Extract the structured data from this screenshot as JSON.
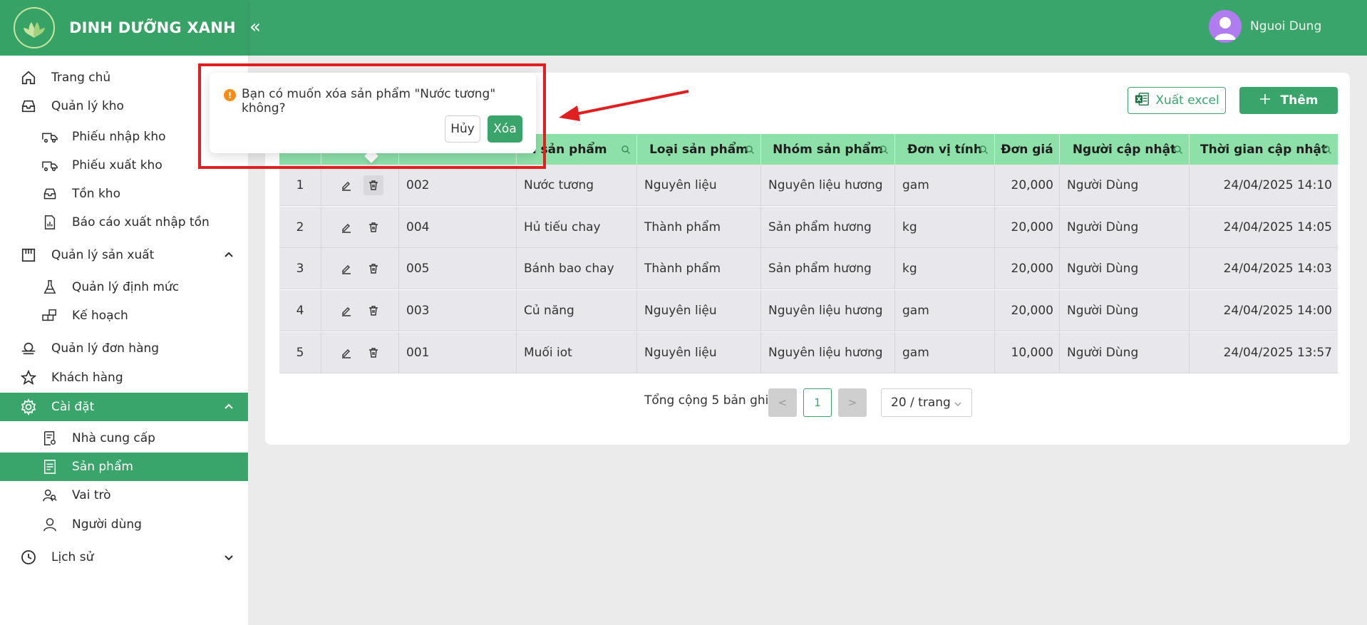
{
  "app": {
    "brand": "DINH DƯỠNG XANH",
    "collapse_icon": "«",
    "user_name": "Nguoi Dung"
  },
  "sidebar": {
    "home": "Trang chủ",
    "warehouse": "Quản lý kho",
    "warehouse_items": [
      "Phiếu nhập kho",
      "Phiếu xuất kho",
      "Tồn kho",
      "Báo cáo xuất nhập tồn"
    ],
    "production": "Quản lý sản xuất",
    "production_items": [
      "Quản lý định mức",
      "Kế hoạch"
    ],
    "orders": "Quản lý đơn hàng",
    "customers": "Khách hàng",
    "settings": "Cài đặt",
    "settings_items": [
      "Nhà cung cấp",
      "Sản phẩm",
      "Vai trò",
      "Người dùng"
    ],
    "history": "Lịch sử"
  },
  "toolbar": {
    "excel_label": "Xuất excel",
    "add_label": "Thêm"
  },
  "table": {
    "headers": {
      "name": "ên sản phẩm",
      "type": "Loại sản phẩm",
      "group": "Nhóm sản phẩm",
      "unit": "Đơn vị tính",
      "price": "Đơn giá",
      "updater": "Người cập nhật",
      "updated_at": "Thời gian cập nhật"
    },
    "rows": [
      {
        "stt": "1",
        "code": "002",
        "name": "Nước tương",
        "type": "Nguyên liệu",
        "group": "Nguyên liệu hương",
        "unit": "gam",
        "price": "20,000",
        "updater": "Người Dùng",
        "updated_at": "24/04/2025 14:10"
      },
      {
        "stt": "2",
        "code": "004",
        "name": "Hủ tiếu chay",
        "type": "Thành phẩm",
        "group": "Sản phẩm hương",
        "unit": "kg",
        "price": "20,000",
        "updater": "Người Dùng",
        "updated_at": "24/04/2025 14:05"
      },
      {
        "stt": "3",
        "code": "005",
        "name": "Bánh bao chay",
        "type": "Thành phẩm",
        "group": "Sản phẩm hương",
        "unit": "kg",
        "price": "20,000",
        "updater": "Người Dùng",
        "updated_at": "24/04/2025 14:03"
      },
      {
        "stt": "4",
        "code": "003",
        "name": "Củ năng",
        "type": "Nguyên liệu",
        "group": "Nguyên liệu hương",
        "unit": "gam",
        "price": "20,000",
        "updater": "Người Dùng",
        "updated_at": "24/04/2025 14:00"
      },
      {
        "stt": "5",
        "code": "001",
        "name": "Muối iot",
        "type": "Nguyên liệu",
        "group": "Nguyên liệu hương",
        "unit": "gam",
        "price": "10,000",
        "updater": "Người Dùng",
        "updated_at": "24/04/2025 13:57"
      }
    ]
  },
  "pagination": {
    "total": "Tổng cộng 5 bản ghi",
    "current_page": "1",
    "prev": "<",
    "next": ">",
    "page_size": "20 / trang"
  },
  "popconfirm": {
    "message": "Bạn có muốn xóa sản phẩm \"Nước tương\" không?",
    "cancel": "Hủy",
    "ok": "Xóa",
    "warn_icon": "!"
  },
  "colors": {
    "primary": "#3aa56b",
    "header_table": "#8ee0a9",
    "annotation": "#e02020",
    "warning": "#fa8c16"
  }
}
